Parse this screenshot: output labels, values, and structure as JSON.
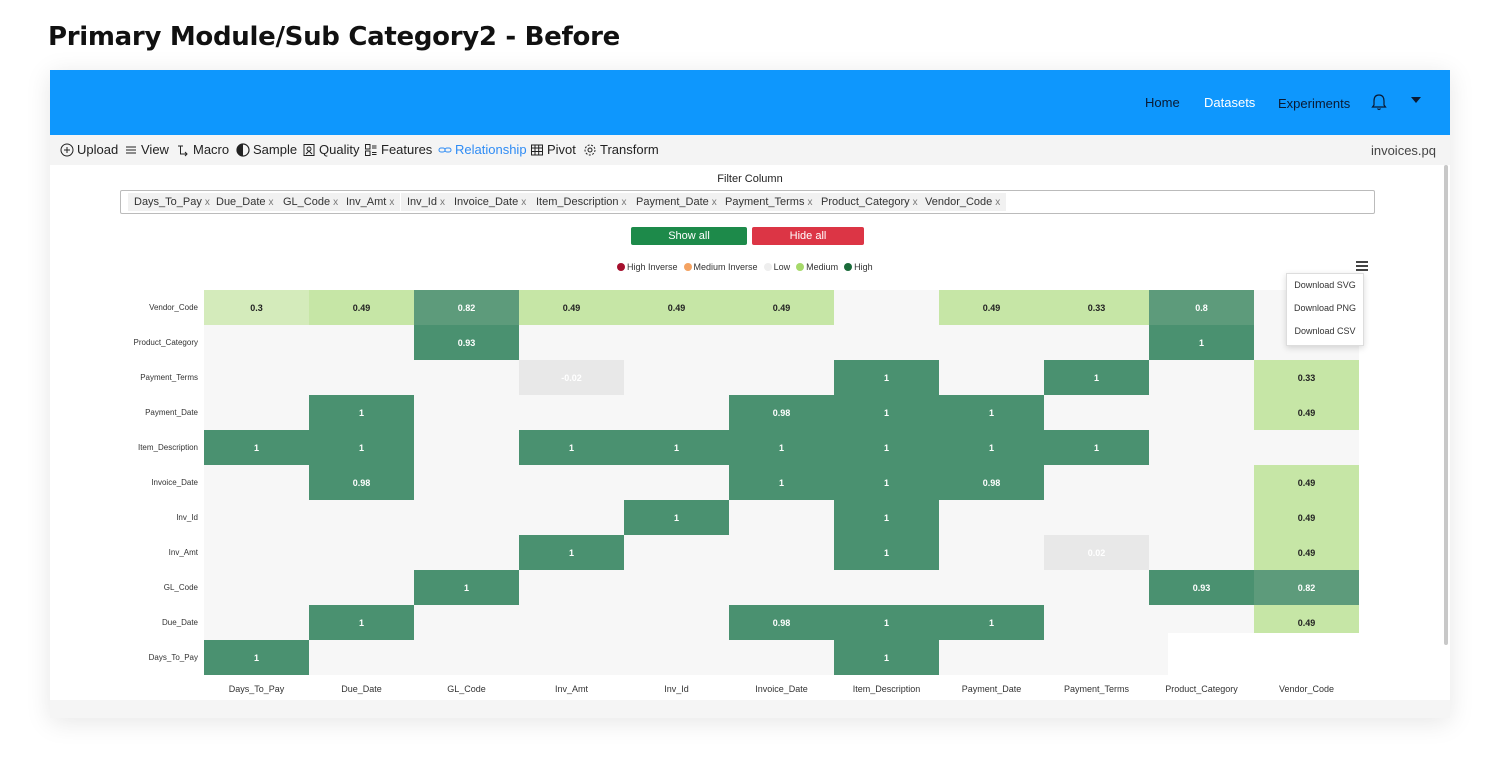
{
  "page_title": "Primary Module/Sub Category2 - Before",
  "nav": {
    "links": [
      "Home",
      "Datasets",
      "Experiments"
    ],
    "active": "Datasets",
    "bell_icon": "bell-icon",
    "account_icon": "caret-down-icon"
  },
  "toolbar": {
    "items": [
      {
        "label": "Upload",
        "icon": "upload-circle-plus-icon"
      },
      {
        "label": "View",
        "icon": "list-icon"
      },
      {
        "label": "Macro",
        "icon": "macro-icon"
      },
      {
        "label": "Sample",
        "icon": "half-circle-icon"
      },
      {
        "label": "Quality",
        "icon": "quality-icon"
      },
      {
        "label": "Features",
        "icon": "features-icon"
      },
      {
        "label": "Relationship",
        "icon": "link-icon"
      },
      {
        "label": "Pivot",
        "icon": "table-icon"
      },
      {
        "label": "Transform",
        "icon": "gear-icon"
      }
    ],
    "active": "Relationship",
    "file_name": "invoices.pq"
  },
  "filter": {
    "label": "Filter Column",
    "tags": [
      "Days_To_Pay",
      "Due_Date",
      "GL_Code",
      "Inv_Amt",
      "Inv_Id",
      "Invoice_Date",
      "Item_Description",
      "Payment_Date",
      "Payment_Terms",
      "Product_Category",
      "Vendor_Code"
    ],
    "remove_glyph": "x",
    "show_all": "Show all",
    "hide_all": "Hide all"
  },
  "legend": [
    {
      "label": "High Inverse",
      "color": "#a50f2d"
    },
    {
      "label": "Medium Inverse",
      "color": "#f4a261"
    },
    {
      "label": "Low",
      "color": "#eeeeee"
    },
    {
      "label": "Medium",
      "color": "#a6d96a"
    },
    {
      "label": "High",
      "color": "#1a6b3a"
    }
  ],
  "export_menu": [
    "Download SVG",
    "Download PNG",
    "Download CSV"
  ],
  "chart_data": {
    "type": "heatmap",
    "x_categories": [
      "Days_To_Pay",
      "Due_Date",
      "GL_Code",
      "Inv_Amt",
      "Inv_Id",
      "Invoice_Date",
      "Item_Description",
      "Payment_Date",
      "Payment_Terms",
      "Product_Category",
      "Vendor_Code"
    ],
    "y_categories": [
      "Vendor_Code",
      "Product_Category",
      "Payment_Terms",
      "Payment_Date",
      "Item_Description",
      "Invoice_Date",
      "Inv_Id",
      "Inv_Amt",
      "GL_Code",
      "Due_Date",
      "Days_To_Pay"
    ],
    "values": [
      [
        0.3,
        0.49,
        0.82,
        0.49,
        0.49,
        0.49,
        null,
        0.49,
        0.33,
        0.8,
        null
      ],
      [
        null,
        null,
        0.93,
        null,
        null,
        null,
        null,
        null,
        null,
        1,
        null
      ],
      [
        null,
        null,
        null,
        -0.02,
        null,
        null,
        1,
        null,
        1,
        null,
        0.33
      ],
      [
        null,
        1,
        null,
        null,
        null,
        0.98,
        1,
        1,
        null,
        null,
        0.49
      ],
      [
        1,
        1,
        null,
        1,
        1,
        1,
        1,
        1,
        1,
        null,
        null
      ],
      [
        null,
        0.98,
        null,
        null,
        null,
        1,
        1,
        0.98,
        null,
        null,
        0.49
      ],
      [
        null,
        null,
        null,
        null,
        1,
        null,
        1,
        null,
        null,
        null,
        0.49
      ],
      [
        null,
        null,
        null,
        1,
        null,
        null,
        1,
        null,
        0.02,
        null,
        0.49
      ],
      [
        null,
        null,
        1,
        null,
        null,
        null,
        null,
        null,
        null,
        0.93,
        0.82
      ],
      [
        null,
        1,
        null,
        null,
        null,
        0.98,
        1,
        1,
        null,
        null,
        0.49
      ],
      [
        1,
        null,
        null,
        null,
        null,
        null,
        1,
        null,
        null,
        null,
        null
      ]
    ],
    "colors": {
      "high": "#4a9170",
      "high_light": "#5d9b7b",
      "medium": "#c6e6a6",
      "medium_light": "#d4ebbb",
      "low": "#f7f7f7",
      "low_neg": "#e8e8e8"
    }
  }
}
